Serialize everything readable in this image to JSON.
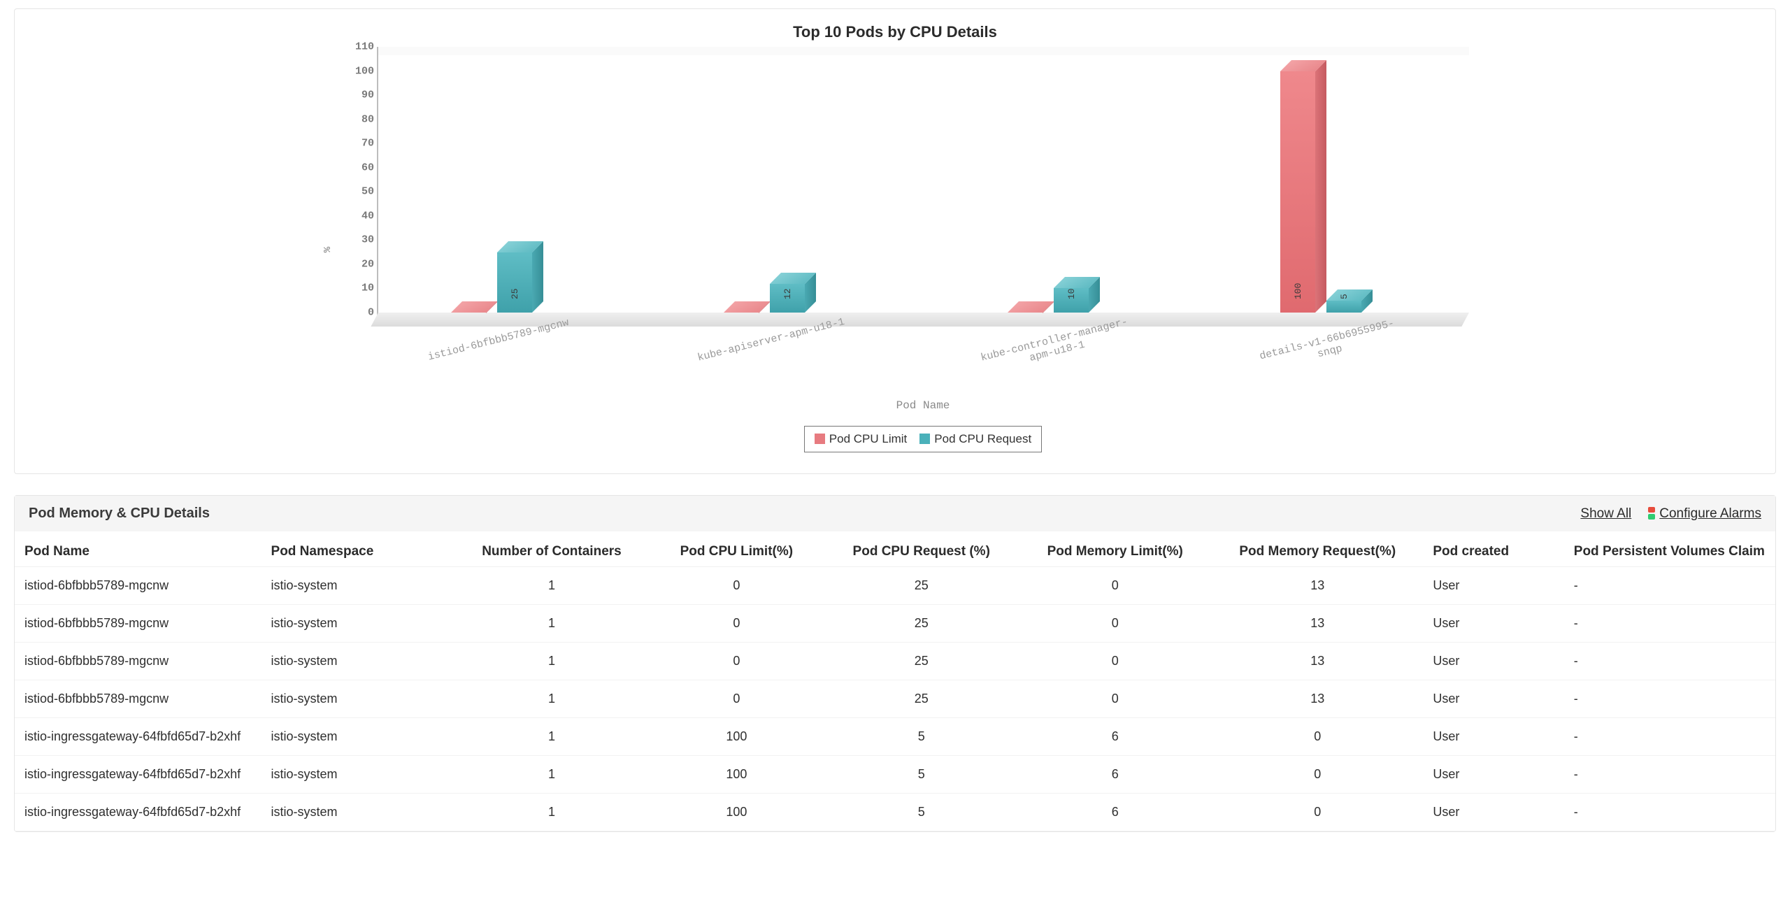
{
  "chart_data": {
    "type": "bar",
    "title": "Top 10 Pods by CPU Details",
    "xlabel": "Pod Name",
    "ylabel": "%",
    "ylim": [
      0,
      110
    ],
    "yticks": [
      0,
      10,
      20,
      30,
      40,
      50,
      60,
      70,
      80,
      90,
      100,
      110
    ],
    "categories": [
      "istiod-6bfbbb5789-mgcnw",
      "kube-apiserver-apm-u18-1",
      "kube-controller-manager-apm-u18-1",
      "details-v1-66b6955995-snqp"
    ],
    "category_display": [
      "istiod-6bfbbb5789-mgcnw",
      "kube-apiserver-apm-u18-1",
      "kube-controller-manager-\napm-u18-1",
      "details-v1-66b6955995-\nsnqp"
    ],
    "series": [
      {
        "name": "Pod CPU Limit",
        "color": "#e77b80",
        "values": [
          0,
          0,
          0,
          100
        ]
      },
      {
        "name": "Pod CPU Request",
        "color": "#4ab1ba",
        "values": [
          25,
          12,
          10,
          5
        ]
      }
    ],
    "legend_position": "bottom"
  },
  "legend": {
    "limit": "Pod CPU Limit",
    "request": "Pod CPU Request"
  },
  "table": {
    "title": "Pod Memory & CPU Details",
    "actions": {
      "show_all": "Show All",
      "configure_alarms": "Configure Alarms"
    },
    "columns": [
      "Pod Name",
      "Pod Namespace",
      "Number of Containers",
      "Pod CPU Limit(%)",
      "Pod CPU Request (%)",
      "Pod Memory Limit(%)",
      "Pod Memory Request(%)",
      "Pod created",
      "Pod Persistent Volumes Claim"
    ],
    "rows": [
      {
        "name": "istiod-6bfbbb5789-mgcnw",
        "ns": "istio-system",
        "nc": "1",
        "cl": "0",
        "cr": "25",
        "ml": "0",
        "mr": "13",
        "created": "User",
        "pvc": "-"
      },
      {
        "name": "istiod-6bfbbb5789-mgcnw",
        "ns": "istio-system",
        "nc": "1",
        "cl": "0",
        "cr": "25",
        "ml": "0",
        "mr": "13",
        "created": "User",
        "pvc": "-"
      },
      {
        "name": "istiod-6bfbbb5789-mgcnw",
        "ns": "istio-system",
        "nc": "1",
        "cl": "0",
        "cr": "25",
        "ml": "0",
        "mr": "13",
        "created": "User",
        "pvc": "-"
      },
      {
        "name": "istiod-6bfbbb5789-mgcnw",
        "ns": "istio-system",
        "nc": "1",
        "cl": "0",
        "cr": "25",
        "ml": "0",
        "mr": "13",
        "created": "User",
        "pvc": "-"
      },
      {
        "name": "istio-ingressgateway-64fbfd65d7-b2xhf",
        "ns": "istio-system",
        "nc": "1",
        "cl": "100",
        "cr": "5",
        "ml": "6",
        "mr": "0",
        "created": "User",
        "pvc": "-"
      },
      {
        "name": "istio-ingressgateway-64fbfd65d7-b2xhf",
        "ns": "istio-system",
        "nc": "1",
        "cl": "100",
        "cr": "5",
        "ml": "6",
        "mr": "0",
        "created": "User",
        "pvc": "-"
      },
      {
        "name": "istio-ingressgateway-64fbfd65d7-b2xhf",
        "ns": "istio-system",
        "nc": "1",
        "cl": "100",
        "cr": "5",
        "ml": "6",
        "mr": "0",
        "created": "User",
        "pvc": "-"
      }
    ]
  }
}
